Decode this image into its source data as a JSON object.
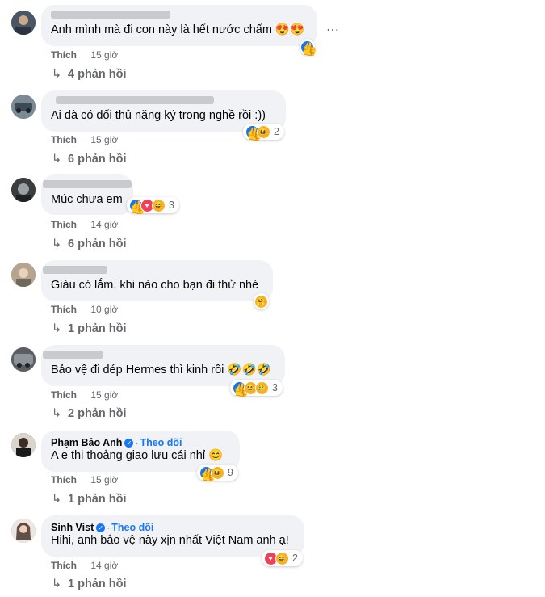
{
  "actions": {
    "like_label": "Thích",
    "follow_label": "Theo dõi",
    "more_icon": "⋯"
  },
  "colors": {
    "accent": "#1877f2",
    "muted": "#65676b",
    "bubble": "#f0f2f5"
  },
  "comments": [
    {
      "text": "Anh mình mà đi con này là hết nước chấm 😍😍",
      "time": "15 giờ",
      "replies": "4 phản hồi",
      "reaction_count": "",
      "reactions": [
        "like"
      ]
    },
    {
      "text": "Ai dà có đối thủ nặng ký trong nghề rồi :))",
      "time": "15 giờ",
      "replies": "6 phản hồi",
      "reaction_count": "2",
      "reactions": [
        "like",
        "haha"
      ]
    },
    {
      "text": "Múc chưa em",
      "time": "14 giờ",
      "replies": "6 phản hồi",
      "reaction_count": "3",
      "reactions": [
        "like",
        "love",
        "haha"
      ]
    },
    {
      "text": "Giàu có lắm, khi nào cho bạn đi thử nhé",
      "time": "10 giờ",
      "replies": "1 phản hồi",
      "reaction_count": "",
      "reactions": [
        "care"
      ]
    },
    {
      "text": "Bảo vệ đi dép Hermes thì kinh rồi 🤣🤣🤣",
      "time": "15 giờ",
      "replies": "2 phản hồi",
      "reaction_count": "3",
      "reactions": [
        "like",
        "haha",
        "sad"
      ]
    },
    {
      "name": "Phạm Bảo Anh",
      "text": "A e thi thoảng giao lưu cái nhỉ 😊",
      "time": "15 giờ",
      "replies": "1 phản hồi",
      "reaction_count": "9",
      "reactions": [
        "like",
        "haha"
      ]
    },
    {
      "name": "Sinh Vist",
      "text": "Hihi, anh bảo vệ này xịn nhất Việt Nam anh ạ!",
      "time": "14 giờ",
      "replies": "1 phản hồi",
      "reaction_count": "2",
      "reactions": [
        "love",
        "haha"
      ]
    }
  ]
}
